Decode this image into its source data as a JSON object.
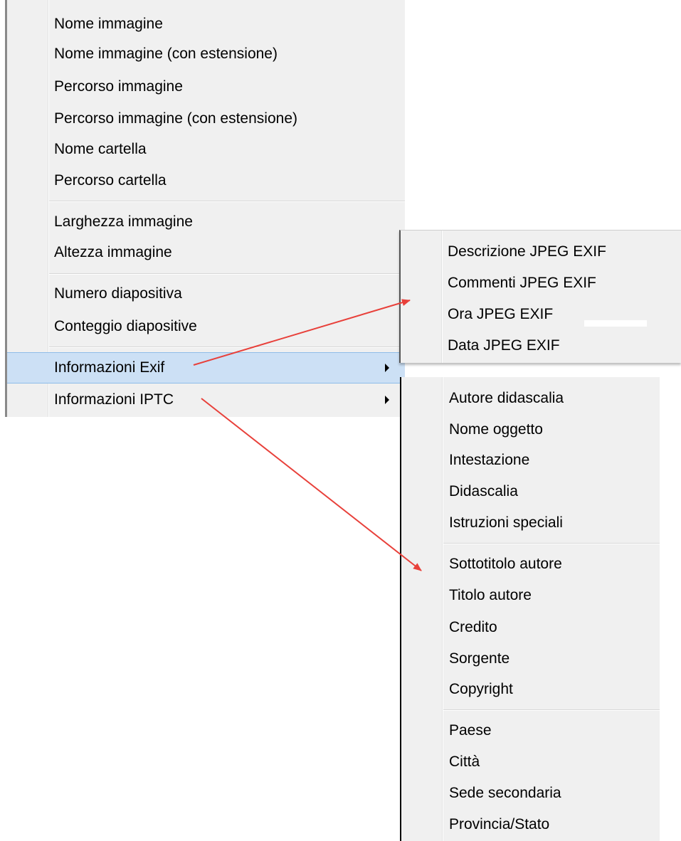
{
  "main_menu": {
    "groups": [
      [
        "Nome immagine",
        "Nome immagine (con estensione)",
        "Percorso immagine",
        "Percorso immagine (con estensione)",
        "Nome cartella",
        "Percorso cartella"
      ],
      [
        "Larghezza immagine",
        "Altezza immagine"
      ],
      [
        "Numero diapositiva",
        "Conteggio diapositive"
      ]
    ],
    "exif_label": "Informazioni Exif",
    "iptc_label": "Informazioni IPTC"
  },
  "exif_submenu": {
    "items": [
      "Descrizione JPEG EXIF",
      "Commenti JPEG EXIF",
      "Ora JPEG EXIF",
      "Data JPEG EXIF"
    ]
  },
  "iptc_submenu": {
    "groups": [
      [
        "Autore didascalia",
        "Nome oggetto",
        "Intestazione",
        "Didascalia",
        "Istruzioni speciali"
      ],
      [
        "Sottotitolo autore",
        "Titolo autore",
        "Credito",
        "Sorgente",
        "Copyright"
      ],
      [
        "Paese",
        "Città",
        "Sede secondaria",
        "Provincia/Stato"
      ]
    ]
  },
  "colors": {
    "menu_bg": "#f0f0f0",
    "highlight": "#cce0f5",
    "annotation_arrow": "#e8403a"
  }
}
